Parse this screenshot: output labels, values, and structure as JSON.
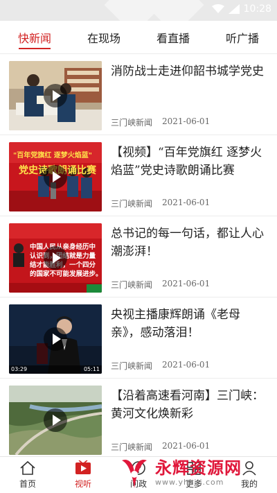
{
  "status_bar": {
    "time": "10:28"
  },
  "tabs": [
    {
      "label": "快新闻",
      "active": true
    },
    {
      "label": "在现场",
      "active": false
    },
    {
      "label": "看直播",
      "active": false
    },
    {
      "label": "听广播",
      "active": false
    }
  ],
  "news": [
    {
      "title": "消防战士走进仰韶书城学党史",
      "source": "三门峡新闻",
      "date": "2021-06-01"
    },
    {
      "title": "【视频】“百年党旗红 逐梦火焰蓝”党史诗歌朗诵比赛",
      "source": "三门峡新闻",
      "date": "2021-06-01"
    },
    {
      "title": "总书记的每一句话，都让人心潮澎湃！",
      "source": "三门峡新闻",
      "date": "2021-06-01"
    },
    {
      "title": "央视主播康辉朗诵《老母亲》，感动落泪！",
      "source": "三门峡新闻",
      "date": "2021-06-01"
    },
    {
      "title": "【沿着高速看河南】三门峡：黄河文化焕新彩",
      "source": "三门峡新闻",
      "date": "2021-06-01"
    }
  ],
  "thumb_text": {
    "banner_line1": "\"百年党旗红 逐梦火焰蓝\"",
    "banner_line2": "党史诗歌朗诵比赛",
    "quote_lines": [
      "中国人民从亲身经历中",
      "认识到，团结就是力量",
      "结才能胜利，一个四分",
      "的国家不可能发展进步。"
    ],
    "video_time": "03:29",
    "video_total": "05:11"
  },
  "bottom_nav": [
    {
      "label": "首页",
      "icon": "home-icon",
      "active": false
    },
    {
      "label": "视听",
      "icon": "video-play-icon",
      "active": true
    },
    {
      "label": "问政",
      "icon": "question-icon",
      "active": false
    },
    {
      "label": "更多",
      "icon": "more-icon",
      "active": false
    },
    {
      "label": "我的",
      "icon": "user-icon",
      "active": false
    }
  ],
  "watermark": {
    "text": "永辉资源网",
    "url": "www.yhkjjj.com"
  },
  "colors": {
    "accent": "#d22222",
    "watermark": "#e0173a"
  }
}
